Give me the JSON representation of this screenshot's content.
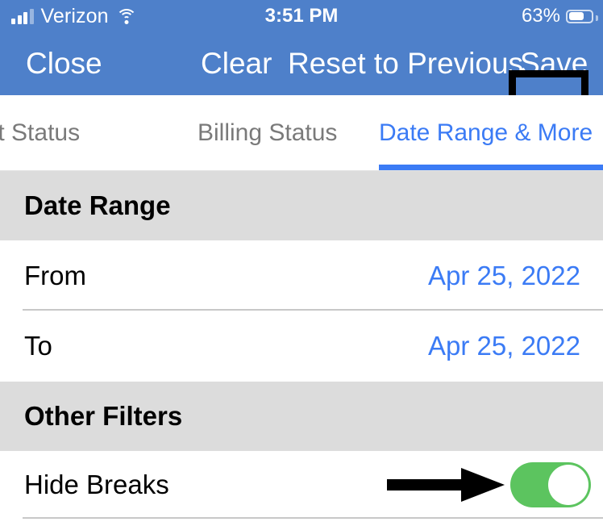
{
  "status_bar": {
    "carrier": "Verizon",
    "signal_icon": "cellular-bars-icon",
    "signal_bars_filled": 3,
    "signal_bars_total": 4,
    "wifi_icon": "wifi-icon",
    "time": "3:51 PM",
    "battery_percent": "63%",
    "battery_level": 63,
    "battery_icon": "battery-icon"
  },
  "nav_bar": {
    "close_label": "Close",
    "clear_label": "Clear",
    "reset_label": "Reset to Previous",
    "save_label": "Save",
    "background_color": "#4e80ca",
    "highlight_color": "#000000"
  },
  "tabs": [
    {
      "label": "ntment Status",
      "active": false
    },
    {
      "label": "Billing Status",
      "active": false
    },
    {
      "label": "Date Range & More",
      "active": true
    }
  ],
  "tab_accent_color": "#3b7bf5",
  "sections": [
    {
      "title": "Date Range",
      "rows": [
        {
          "label": "From",
          "value": "Apr 25, 2022",
          "type": "date"
        },
        {
          "label": "To",
          "value": "Apr 25, 2022",
          "type": "date"
        }
      ]
    },
    {
      "title": "Other Filters",
      "rows": [
        {
          "label": "Hide Breaks",
          "type": "toggle",
          "toggle_on": true
        }
      ]
    }
  ],
  "toggle": {
    "on_color": "#5cc45f",
    "knob_color": "#ffffff",
    "state": "on"
  },
  "annotation": {
    "arrow_icon": "arrow-right-icon",
    "arrow_color": "#000000",
    "points_to": "Hide Breaks toggle"
  }
}
